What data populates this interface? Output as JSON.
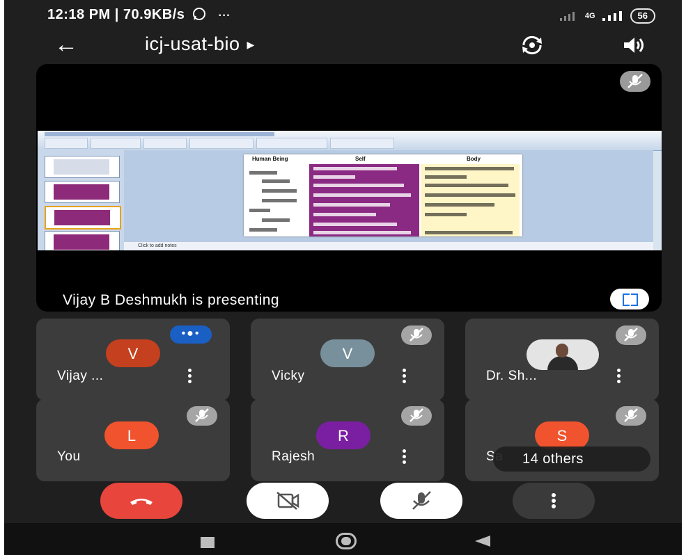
{
  "status_bar": {
    "time_speed": "12:18 PM | 70.9KB/s",
    "extra": "···",
    "network": "4G",
    "battery": "56"
  },
  "appbar": {
    "title": "icj-usat-bio",
    "icons": [
      "back-arrow-icon",
      "switch-camera-icon",
      "speaker-icon"
    ]
  },
  "presentation": {
    "caption": "Vijay B Deshmukh is presenting",
    "slide": {
      "headers": [
        "Human Being",
        "Self",
        "Body"
      ],
      "notes": "Click to add notes"
    }
  },
  "participants": [
    {
      "name": "Vijay ...",
      "initial": "V",
      "color": "#c4401e",
      "state": "speaking"
    },
    {
      "name": "Vicky",
      "initial": "V",
      "color": "#78909c",
      "state": "muted"
    },
    {
      "name": "Dr. Sh...",
      "initial": "",
      "color": "",
      "state": "muted"
    },
    {
      "name": "You",
      "initial": "L",
      "color": "#f0532d",
      "state": "muted"
    },
    {
      "name": "Rajesh",
      "initial": "R",
      "color": "#7b1fa2",
      "state": "muted"
    },
    {
      "name": "Sa",
      "initial": "S",
      "color": "#f0532d",
      "state": "muted"
    }
  ],
  "others": "14 others",
  "controls": [
    "end-call",
    "camera-off",
    "mic-off",
    "more-options"
  ],
  "colors": {
    "background": "#1f1f1f",
    "tile": "#3c3c3c",
    "end_call": "#e8453c",
    "accent_blue": "#1a73e8"
  }
}
